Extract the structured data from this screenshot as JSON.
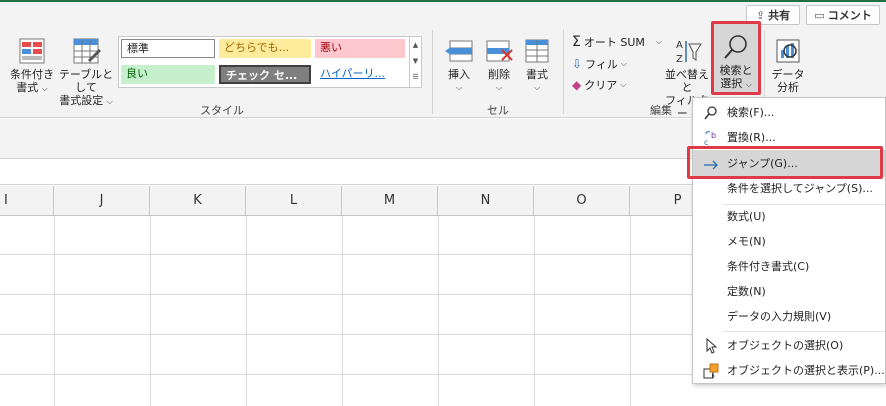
{
  "header": {
    "share_label": "共有",
    "comment_label": "コメント"
  },
  "ribbon": {
    "styles_group": {
      "label": "スタイル",
      "conditional_format": {
        "line1": "条件付き",
        "line2": "書式"
      },
      "format_as_table": {
        "line1": "テーブルとして",
        "line2": "書式設定"
      },
      "cell_styles": [
        {
          "label": "標準",
          "bg": "#ffffff",
          "color": "#222222"
        },
        {
          "label": "どちらでも...",
          "bg": "#ffeb9c",
          "color": "#9c6500"
        },
        {
          "label": "悪い",
          "bg": "#ffc7ce",
          "color": "#9c0006"
        },
        {
          "label": "良い",
          "bg": "#c6efce",
          "color": "#006100"
        },
        {
          "label": "チェック セ...",
          "bg": "#7f7f7f",
          "color": "#ffffff"
        },
        {
          "label": "ハイパーリ...",
          "bg": "#ffffff",
          "color": "#0563c1"
        }
      ]
    },
    "cells_group": {
      "label": "セル",
      "insert": "挿入",
      "delete": "削除",
      "format": "書式"
    },
    "editing_group": {
      "label": "編集",
      "autosum": "オート SUM",
      "fill": "フィル",
      "clear": "クリア",
      "sort_filter": {
        "line1": "並べ替えと",
        "line2": "フィルター"
      },
      "find_select": {
        "line1": "検索と",
        "line2": "選択"
      }
    },
    "analysis_group": {
      "data_analysis": {
        "line1": "データ",
        "line2": "分析"
      }
    }
  },
  "grid": {
    "columns": [
      "I",
      "J",
      "K",
      "L",
      "M",
      "N",
      "O",
      "P"
    ]
  },
  "find_menu": {
    "items": [
      {
        "label": "検索(F)..."
      },
      {
        "label": "置換(R)..."
      },
      {
        "label": "ジャンプ(G)..."
      },
      {
        "label": "条件を選択してジャンプ(S)..."
      },
      {
        "label": "数式(U)"
      },
      {
        "label": "メモ(N)"
      },
      {
        "label": "条件付き書式(C)"
      },
      {
        "label": "定数(N)"
      },
      {
        "label": "データの入力規則(V)"
      },
      {
        "label": "オブジェクトの選択(O)"
      },
      {
        "label": "オブジェクトの選択と表示(P)..."
      }
    ]
  },
  "colors": {
    "highlight": "#e03a49",
    "accent": "#1e7145"
  }
}
